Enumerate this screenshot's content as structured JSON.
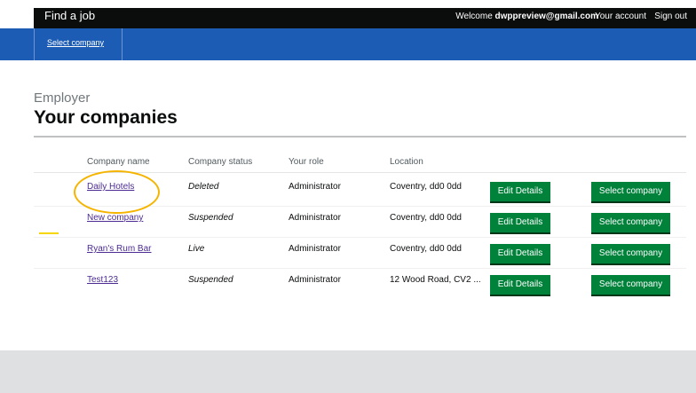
{
  "header": {
    "brand": "Find a job",
    "welcome_prefix": "Welcome ",
    "user_email": "dwppreview@gmail.com",
    "your_account": "Your account",
    "sign_out": "Sign out"
  },
  "nav": {
    "tab_label": "Select company"
  },
  "page": {
    "caption": "Employer",
    "title": "Your companies"
  },
  "table": {
    "headers": [
      "Company name",
      "Company status",
      "Your role",
      "Location"
    ],
    "rows": [
      {
        "name": "Daily Hotels",
        "status": "Deleted",
        "role": "Administrator",
        "location": "Coventry, dd0 0dd",
        "edit": "Edit Details",
        "select": "Select company"
      },
      {
        "name": "New company",
        "status": "Suspended",
        "role": "Administrator",
        "location": "Coventry, dd0 0dd",
        "edit": "Edit Details",
        "select": "Select company"
      },
      {
        "name": "Ryan's Rum Bar",
        "status": "Live",
        "role": "Administrator",
        "location": "Coventry, dd0 0dd",
        "edit": "Edit Details",
        "select": "Select company"
      },
      {
        "name": "Test123",
        "status": "Suspended",
        "role": "Administrator",
        "location": "12 Wood Road, CV2 ...",
        "edit": "Edit Details",
        "select": "Select company"
      }
    ]
  },
  "colors": {
    "header_bg": "#0b0c0c",
    "nav_bg": "#1d5cb4",
    "button_green": "#00823b",
    "link_purple": "#4c2c92",
    "highlight_yellow": "#f5b400"
  }
}
